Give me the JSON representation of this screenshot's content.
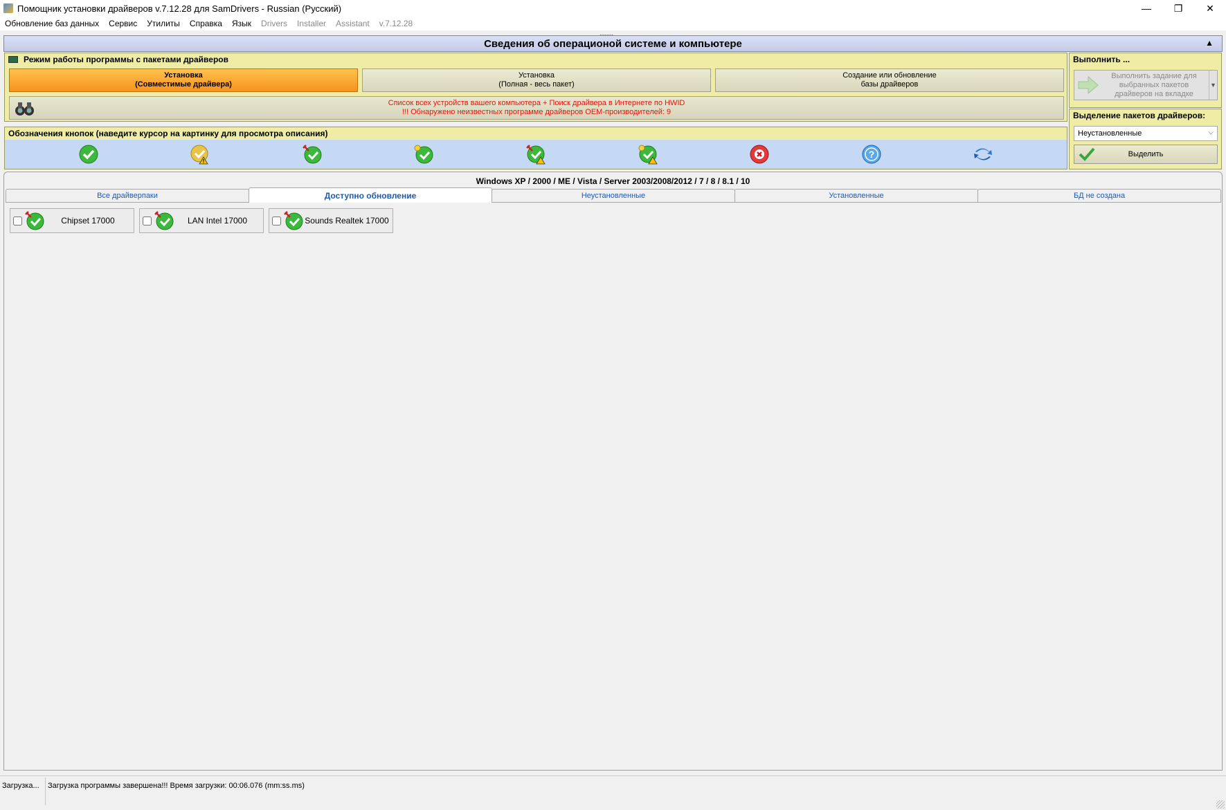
{
  "window": {
    "title": "Помощник установки драйверов v.7.12.28 для SamDrivers - Russian (Русский)",
    "controls": {
      "minimize": "—",
      "restore": "❐",
      "close": "✕"
    }
  },
  "menu": {
    "items": [
      "Обновление баз данных",
      "Сервис",
      "Утилиты",
      "Справка",
      "Язык"
    ],
    "dim_items": [
      "Drivers",
      "Installer",
      "Assistant",
      "v.7.12.28"
    ]
  },
  "grip": "........",
  "header": {
    "title": "Сведения об операционой системе и компьютере",
    "collapse": "▲"
  },
  "mode_panel": {
    "title": "Режим работы программы с пакетами драйверов",
    "buttons": [
      {
        "line1": "Установка",
        "line2": "(Совместимые драйвера)",
        "active": true
      },
      {
        "line1": "Установка",
        "line2": "(Полная - весь пакет)",
        "active": false
      },
      {
        "line1": "Создание или обновление",
        "line2": "базы драйверов",
        "active": false
      }
    ],
    "hwid_line1": "Список всех устройств вашего компьютера + Поиск драйвера в Интернете по HWID",
    "hwid_line2": "!!! Обнаружено неизвестных программе драйверов OEM-производителей: 9"
  },
  "legend_panel": {
    "title": "Обозначения кнопок (наведите курсор на картинку для просмотра описания)",
    "icons": [
      "green-check-icon",
      "yellow-check-warning-icon",
      "green-check-pin-icon",
      "green-check-bulb-icon",
      "green-check-pin-warning-icon",
      "green-check-bulb-warning-icon",
      "red-x-icon",
      "blue-question-icon",
      "blue-refresh-icon"
    ]
  },
  "exec_panel": {
    "title": "Выполнить ...",
    "button_line1": "Выполнить задание для",
    "button_line2": "выбранных пакетов",
    "button_line3": "драйверов на вкладке",
    "dropdown_arrow": "▼"
  },
  "select_panel": {
    "title": "Выделение пакетов драйверов:",
    "combo_value": "Неустановленные",
    "combo_chevron": "⌵",
    "button_label": "Выделить"
  },
  "content": {
    "os_line": "Windows XP / 2000 / ME / Vista / Server 2003/2008/2012 / 7 / 8 / 8.1 / 10",
    "tabs": [
      {
        "label": "Все драйверпаки",
        "active": false
      },
      {
        "label": "Доступно обновление",
        "active": true
      },
      {
        "label": "Неустановленные",
        "active": false
      },
      {
        "label": "Установленные",
        "active": false
      },
      {
        "label": "БД не создана",
        "active": false
      }
    ],
    "packages": [
      {
        "label": "Chipset 17000",
        "checked": false
      },
      {
        "label": "LAN Intel 17000",
        "checked": false
      },
      {
        "label": "Sounds Realtek 17000",
        "checked": false
      }
    ]
  },
  "status": {
    "left": "Загрузка...",
    "message": "Загрузка программы завершена!!! Время загрузки: 00:06.076 (mm:ss.ms)"
  },
  "colors": {
    "accent_orange": "#f7931e",
    "panel_yellow": "#efeca6",
    "legend_blue": "#c5d8f4",
    "tab_link_blue": "#1a5bb8",
    "warning_red": "#e8140c"
  }
}
